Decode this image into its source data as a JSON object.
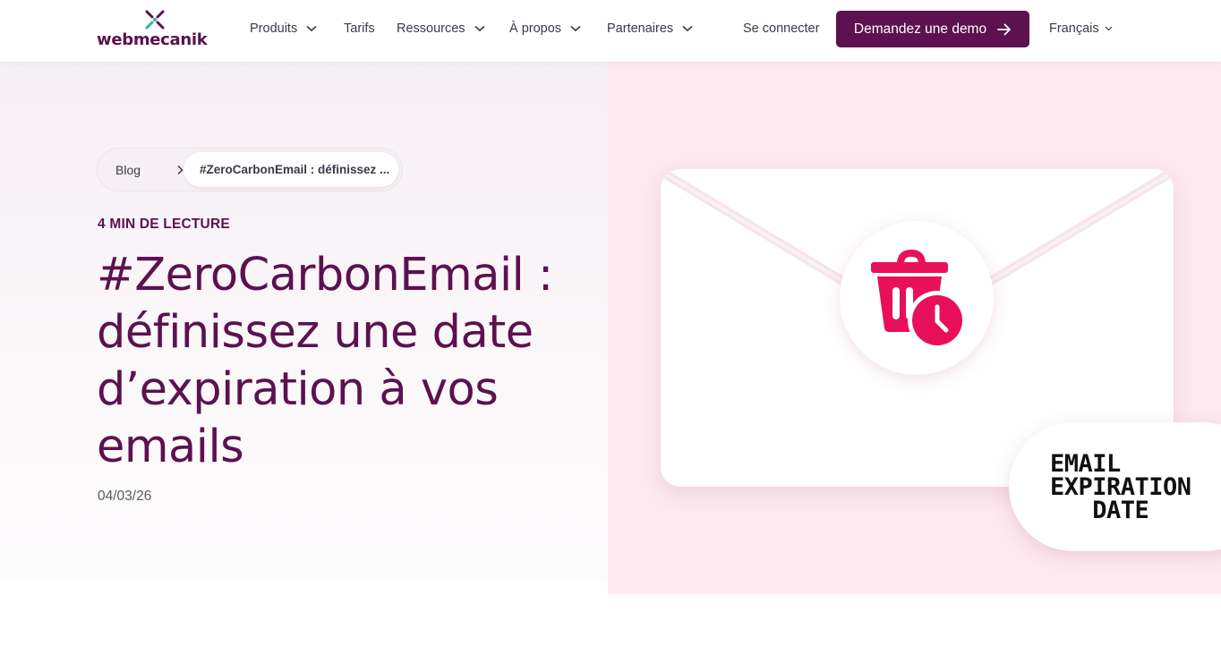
{
  "header": {
    "logo_text": "webmecanik",
    "nav": {
      "produits": "Produits",
      "tarifs": "Tarifs",
      "ressources": "Ressources",
      "apropos": "À propos",
      "partenaires": "Partenaires",
      "login": "Se connecter"
    },
    "cta_label": "Demandez une demo",
    "language": "Français"
  },
  "breadcrumb": {
    "root": "Blog",
    "current": "#ZeroCarbonEmail : définissez ..."
  },
  "article": {
    "read_time": "4 MIN DE LECTURE",
    "title": "#ZeroCarbonEmail : définissez une date d’expiration à vos emails",
    "date": "04/03/26"
  },
  "illustration": {
    "line1": "EMAIL",
    "line2": "EXPIRATION",
    "line3": "DATE",
    "icon": "trash-clock-icon"
  },
  "colors": {
    "brand": "#5c1150",
    "accent": "#e8105a",
    "hero_right_bg": "#fde9ef"
  }
}
